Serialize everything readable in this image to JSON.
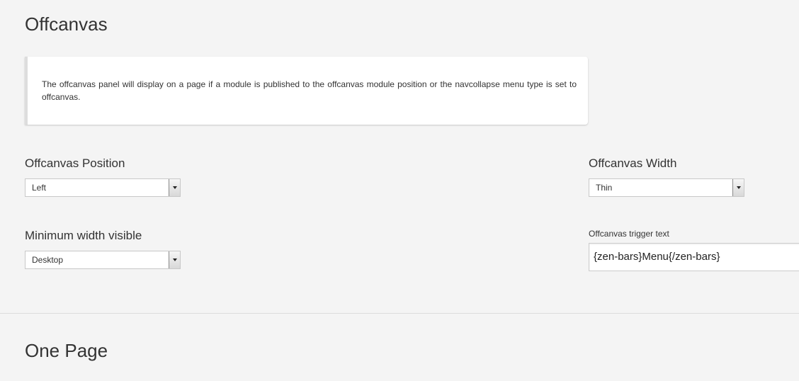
{
  "sections": {
    "offcanvas_title": "Offcanvas",
    "onepage_title": "One Page"
  },
  "info": {
    "text": "The offcanvas panel will display on a page if a module is published to the offcanvas module position or the navcollapse menu type is set to offcanvas."
  },
  "fields": {
    "position": {
      "label": "Offcanvas Position",
      "value": "Left"
    },
    "width": {
      "label": "Offcanvas Width",
      "value": "Thin"
    },
    "min_width": {
      "label": "Minimum width visible",
      "value": "Desktop"
    },
    "trigger_text": {
      "label": "Offcanvas trigger text",
      "value": "{zen-bars}Menu{/zen-bars}"
    }
  },
  "icons": {
    "select_arrow": "chevron-down-icon"
  },
  "colors": {
    "background": "#f4f4f4",
    "text": "#333333",
    "panel": "#ffffff"
  }
}
